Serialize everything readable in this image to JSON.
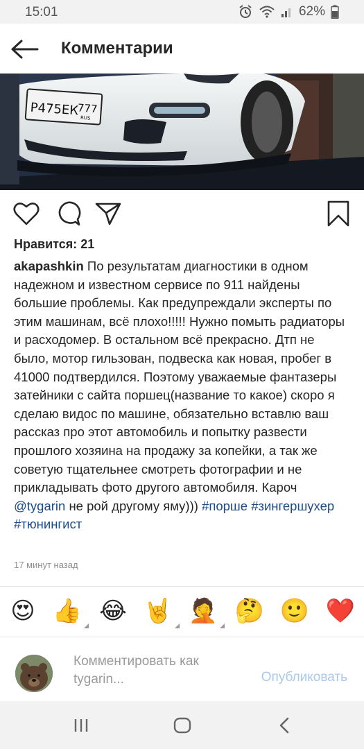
{
  "status_bar": {
    "time": "15:01",
    "battery": "62%"
  },
  "header": {
    "title": "Комментарии"
  },
  "post": {
    "likes_text": "Нравится: 21",
    "author": "akapashkin",
    "caption_text": " По результатам диагностики в одном надежном и известном сервисе по 911 найдены большие проблемы. Как предупреждали эксперты по этим машинам, всё плохо!!!!! Нужно помыть радиаторы и расходомер.  В остальном всё прекрасно. Дтп не было, мотор гильзован, подвеска как новая, пробег в 41000 подтвердился.  Поэтому уважаемые фантазеры затейники с сайта поршец(название то какое) скоро я сделаю видос по машине, обязательно вставлю ваш рассказ про этот автомобиль и попытку развести прошлого хозяина на продажу за копейки, а так же советую тщательнее смотреть фотографии и не прикладывать фото другого автомобиля. Кароч ",
    "mention": "@tygarin",
    "caption_tail": " не рой другому яму))) ",
    "hashtags": [
      "#порше",
      "#зингершухер",
      "#тюнингист"
    ],
    "time_ago": "17 минут назад",
    "plate": {
      "number": "Р475ЕК",
      "region": "777",
      "country": "RUS"
    }
  },
  "emoji_bar": [
    "😍",
    "👍",
    "😂",
    "🤘",
    "🤦",
    "🤔",
    "🙂",
    "❤️"
  ],
  "composer": {
    "placeholder": "Комментировать как tygarin...",
    "publish_label": "Опубликовать"
  },
  "colors": {
    "link": "#1b4b8a",
    "publish": "#a9c8ec",
    "muted": "#8e8e8e"
  }
}
